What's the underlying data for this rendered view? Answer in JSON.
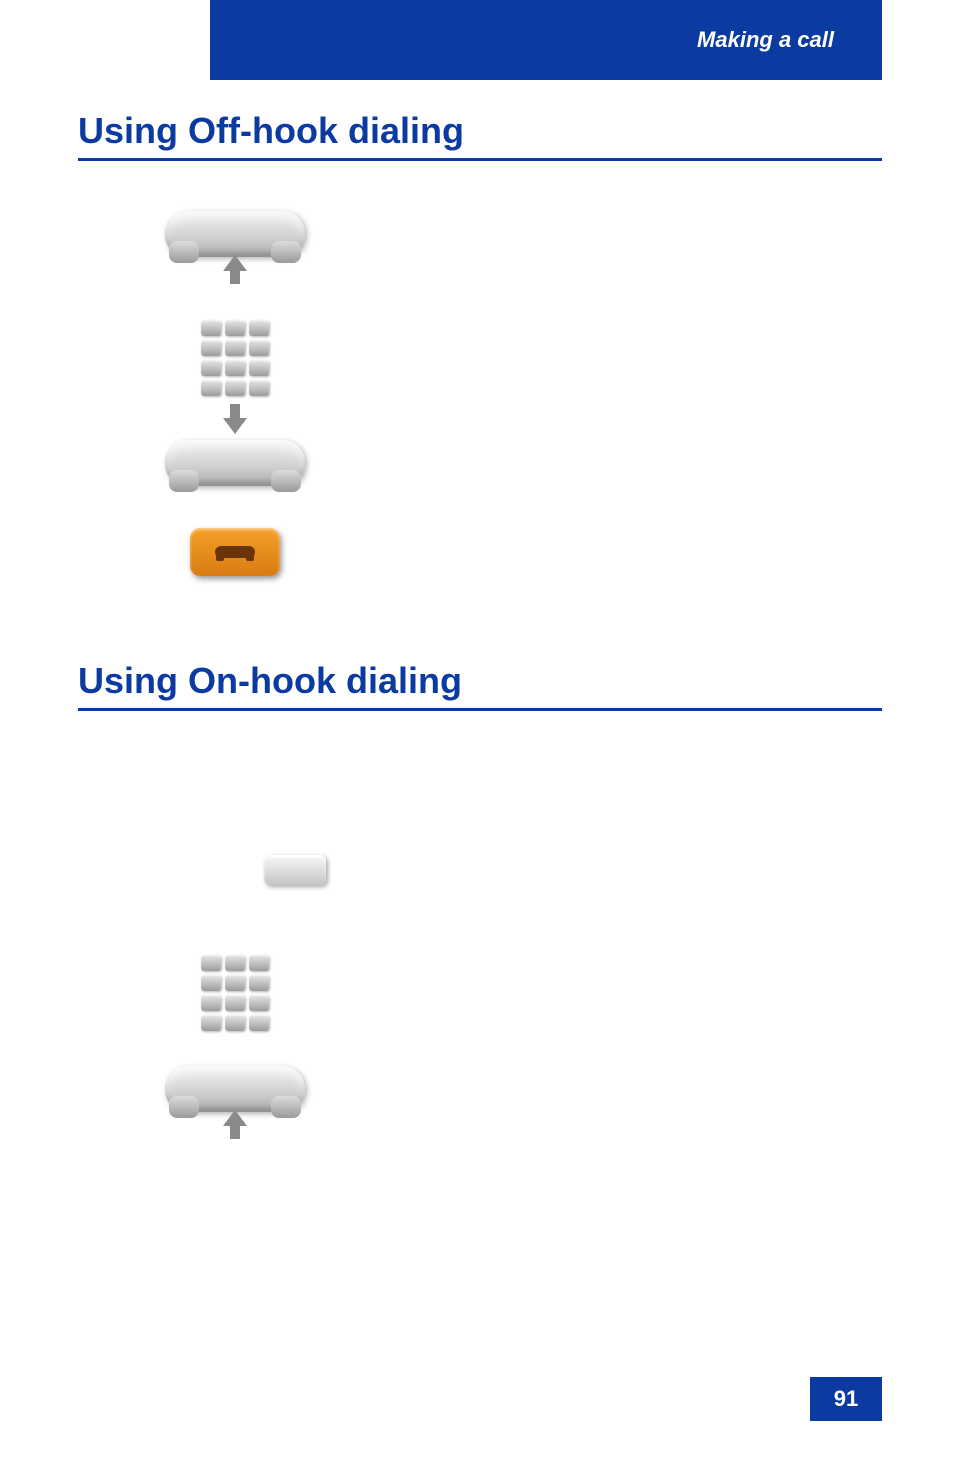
{
  "header": {
    "breadcrumb": "Making a call"
  },
  "sections": {
    "offhook_title": "Using Off-hook dialing",
    "onhook_title": "Using On-hook dialing"
  },
  "icons": {
    "handset_lift": "handset-lift-icon",
    "keypad": "dialpad-icon",
    "handset_replace": "handset-replace-icon",
    "release_key": "goodbye-key-icon",
    "line_key": "line-key-icon"
  },
  "page_number": "91"
}
